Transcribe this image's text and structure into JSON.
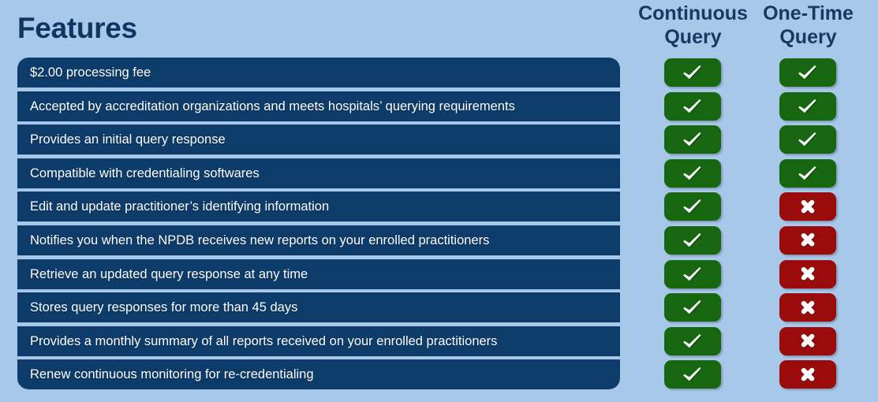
{
  "title": "Features",
  "colors": {
    "background": "#a8c8ea",
    "row_navy": "#0d3c6b",
    "title_navy": "#0f3663",
    "header_navy": "#173a63",
    "yes_green": "#176610",
    "no_red": "#9a0b0b",
    "glyph_white": "#ffffff"
  },
  "columns": [
    {
      "id": "continuous",
      "line1": "Continuous",
      "line2": "Query"
    },
    {
      "id": "onetime",
      "line1": "One-Time",
      "line2": "Query"
    }
  ],
  "icons": {
    "yes": "check-icon",
    "no": "cross-icon"
  },
  "rows": [
    {
      "feature": "$2.00 processing fee",
      "continuous": "yes",
      "onetime": "yes"
    },
    {
      "feature": "Accepted by accreditation organizations and meets hospitals’ querying requirements",
      "continuous": "yes",
      "onetime": "yes"
    },
    {
      "feature": "Provides an initial query response",
      "continuous": "yes",
      "onetime": "yes"
    },
    {
      "feature": "Compatible with credentialing softwares",
      "continuous": "yes",
      "onetime": "yes"
    },
    {
      "feature": "Edit and update practitioner’s identifying information",
      "continuous": "yes",
      "onetime": "no"
    },
    {
      "feature": "Notifies you when the NPDB receives new reports on your enrolled practitioners",
      "continuous": "yes",
      "onetime": "no"
    },
    {
      "feature": "Retrieve an updated query response at any time",
      "continuous": "yes",
      "onetime": "no"
    },
    {
      "feature": "Stores query responses for more than 45 days",
      "continuous": "yes",
      "onetime": "no"
    },
    {
      "feature": "Provides a monthly summary of all reports received on your enrolled practitioners",
      "continuous": "yes",
      "onetime": "no"
    },
    {
      "feature": "Renew continuous monitoring for re-credentialing",
      "continuous": "yes",
      "onetime": "no"
    }
  ]
}
